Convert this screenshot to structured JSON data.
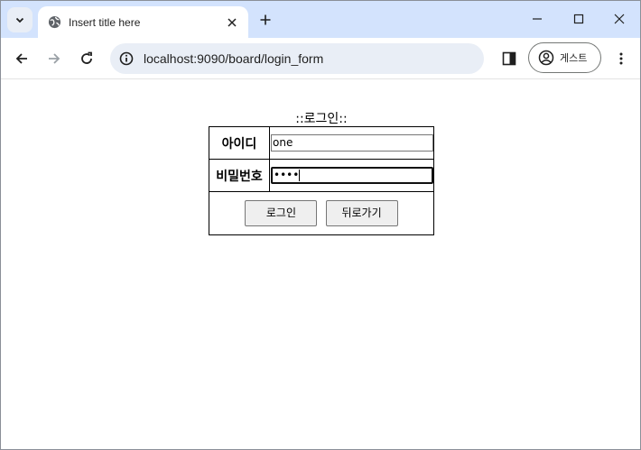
{
  "browser": {
    "tab": {
      "title": "Insert title here"
    },
    "address_bar": {
      "url": "localhost:9090/board/login_form"
    },
    "profile": {
      "label": "게스트"
    }
  },
  "page": {
    "title": "::로그인::",
    "form": {
      "id_label": "아이디",
      "id_value": "one",
      "password_label": "비밀번호",
      "password_value": "••••",
      "login_button": "로그인",
      "back_button": "뒤로가기"
    }
  },
  "icons": {
    "tab_search": "chevron-down-icon",
    "favicon": "globe-icon",
    "tab_close": "close-icon",
    "new_tab": "plus-icon",
    "minimize": "minimize-icon",
    "maximize": "maximize-icon",
    "window_close": "close-icon",
    "back": "arrow-left-icon",
    "forward": "arrow-right-icon",
    "reload": "reload-icon",
    "site_info": "info-icon",
    "side_panel": "side-panel-icon",
    "profile": "person-icon",
    "menu": "more-vertical-icon"
  },
  "colors": {
    "tabstrip": "#d3e3fd",
    "omnibox": "#e9eef6",
    "button_bg": "#efefef"
  }
}
